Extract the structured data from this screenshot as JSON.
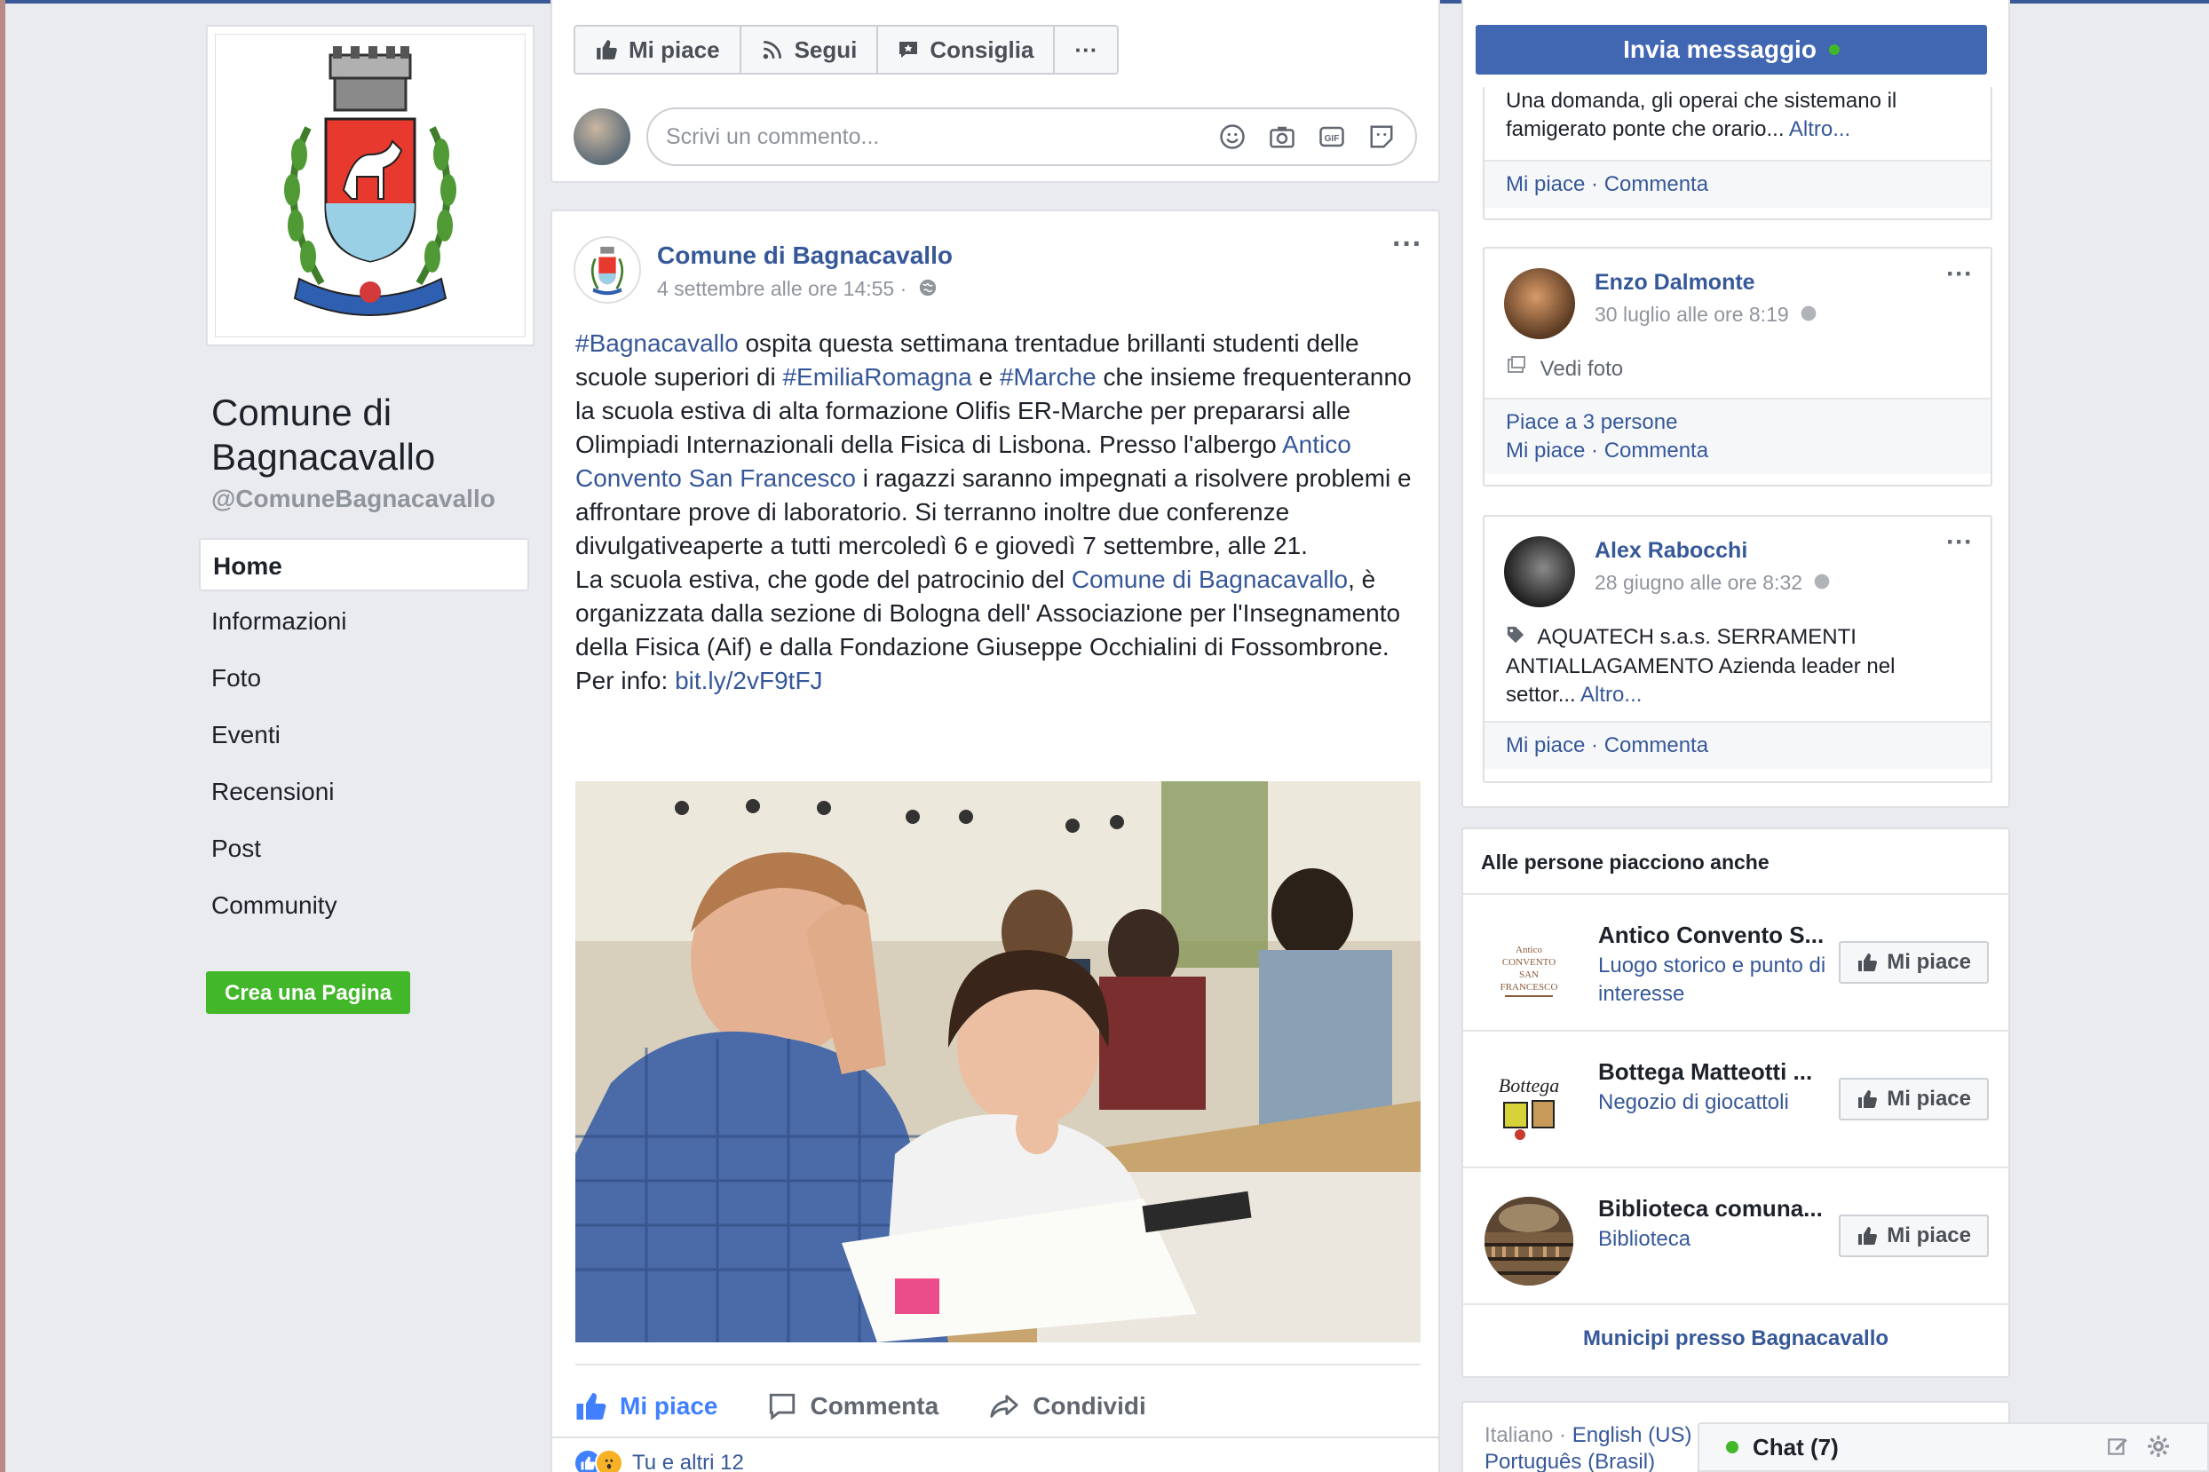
{
  "page": {
    "name": "Comune di Bagnacavallo",
    "handle": "@ComuneBagnacavallo"
  },
  "nav": {
    "items": [
      "Home",
      "Informazioni",
      "Foto",
      "Eventi",
      "Recensioni",
      "Post",
      "Community"
    ],
    "create_page": "Crea una Pagina"
  },
  "actions": {
    "like": "Mi piace",
    "follow": "Segui",
    "recommend": "Consiglia",
    "more": "···",
    "send_message": "Invia messaggio"
  },
  "composer": {
    "placeholder": "Scrivi un commento..."
  },
  "post": {
    "author": "Comune di Bagnacavallo",
    "time": "4 settembre alle ore 14:55 ·",
    "text": {
      "tag1": "#Bagnacavallo",
      "t1": " ospita questa settimana trentadue brillanti studenti delle scuole superiori di ",
      "tag2": "#EmiliaRomagna",
      "t2": " e ",
      "tag3": "#Marche",
      "t3": " che insieme frequenteranno la scuola estiva di alta formazione Olifis ER-Marche per prepararsi alle Olimpiadi Internazionali della Fisica di Lisbona. Presso l'albergo ",
      "link1": "Antico Convento San Francesco",
      "t4": " i ragazzi saranno impegnati a risolvere problemi e affrontare prove di laboratorio. Si terranno inoltre due conferenze divulgativeaperte a tutti mercoledì 6 e giovedì 7 settembre, alle 21.",
      "t5": "La scuola estiva, che gode del patrocinio del ",
      "link2": "Comune di Bagnacavallo",
      "t6": ", è organizzata dalla sezione di Bologna dell' Associazione per l'Insegnamento della Fisica (Aif) e dalla Fondazione Giuseppe Occhialini di Fossombrone.",
      "t7": "Per info: ",
      "link3": "bit.ly/2vF9tFJ"
    },
    "like": "Mi piace",
    "comment": "Comment­a",
    "share": "Condividi",
    "reactions": "Tu e altri 12"
  },
  "sidebar_posts": [
    {
      "text": "Una domanda, gli operai che sistemano il famigerato ponte che orario...",
      "more": "Altro...",
      "footer": "Mi piace · Commenta"
    },
    {
      "name": "Enzo Dalmonte",
      "date": "30 luglio alle ore 8:19",
      "body": "Vedi foto",
      "likes": "Piace a 3 persone",
      "footer": "Mi piace · Commenta"
    },
    {
      "name": "Alex Rabocchi",
      "date": "28 giugno alle ore 8:32",
      "body": "AQUATECH s.a.s. SERRAMENTI ANTIALLAGAMENTO Azienda leader nel settor...",
      "more": "Altro...",
      "footer": "Mi piace · Commenta"
    }
  ],
  "people_also_like": {
    "title": "Alle persone piacciono anche",
    "items": [
      {
        "name": "Antico Convento S...",
        "category": "Luogo storico e punto di interesse",
        "button": "Mi piace"
      },
      {
        "name": "Bottega Matteotti ...",
        "category": "Negozio di giocattoli",
        "button": "Mi piace"
      },
      {
        "name": "Biblioteca comuna...",
        "category": "Biblioteca",
        "button": "Mi piace"
      }
    ],
    "more": "Municipi presso Bagnacavallo"
  },
  "languages": {
    "current": "Italiano ·",
    "english": "English (US)",
    "portuguese": "Português (Brasil)"
  },
  "chat": {
    "label": "Chat (7)"
  },
  "colors": {
    "brand": "#3b5998",
    "link": "#365899",
    "send_button": "#4267b2",
    "green": "#42b72a",
    "like_blue": "#4080ff"
  }
}
